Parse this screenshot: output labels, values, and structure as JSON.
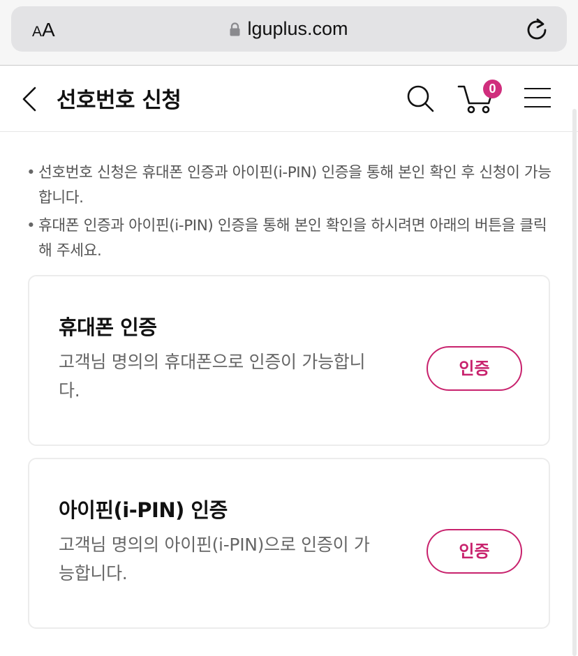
{
  "browser": {
    "text_size_label_small": "A",
    "text_size_label_large": "A",
    "url": "lguplus.com"
  },
  "header": {
    "title": "선호번호 신청",
    "cart_count": "0"
  },
  "notices": [
    "선호번호 신청은 휴대폰 인증과 아이핀(i-PIN) 인증을 통해 본인 확인 후 신청이 가능합니다.",
    "휴대폰 인증과 아이핀(i-PIN) 인증을 통해 본인 확인을 하시려면 아래의 버튼을 클릭해 주세요."
  ],
  "cards": [
    {
      "title": "휴대폰 인증",
      "description": "고객님 명의의 휴대폰으로 인증이 가능합니다.",
      "button_label": "인증"
    },
    {
      "title": "아이핀(i-PIN) 인증",
      "description": "고객님 명의의 아이핀(i-PIN)으로 인증이 가능합니다.",
      "button_label": "인증"
    }
  ],
  "icons": {
    "back": "chevron-left-icon",
    "search": "search-icon",
    "cart": "cart-icon",
    "menu": "hamburger-menu-icon",
    "lock": "lock-icon",
    "reload": "reload-icon"
  },
  "colors": {
    "accent": "#c8226d",
    "badge": "#d02e7d"
  }
}
